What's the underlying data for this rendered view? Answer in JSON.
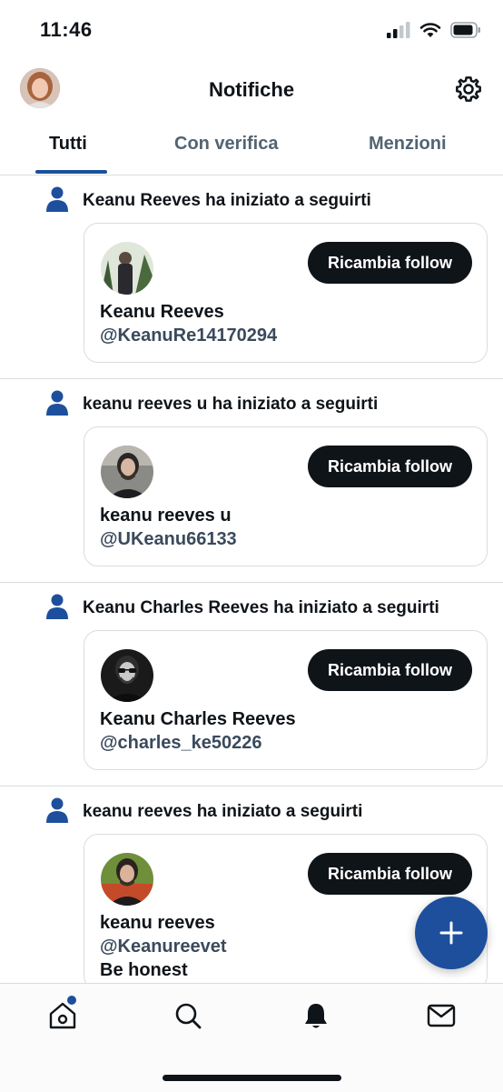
{
  "status_bar": {
    "time": "11:46"
  },
  "header": {
    "title": "Notifiche"
  },
  "tabs": [
    {
      "label": "Tutti",
      "active": true
    },
    {
      "label": "Con verifica",
      "active": false
    },
    {
      "label": "Menzioni",
      "active": false
    }
  ],
  "notifications": [
    {
      "text": "Keanu Reeves ha iniziato a seguirti",
      "name": "Keanu Reeves",
      "handle": "@KeanuRe14170294",
      "button": "Ricambia follow"
    },
    {
      "text": "keanu reeves u ha iniziato a seguirti",
      "name": "keanu reeves u",
      "handle": "@UKeanu66133",
      "button": "Ricambia follow"
    },
    {
      "text": "Keanu Charles Reeves ha iniziato a seguirti",
      "name": "Keanu Charles Reeves",
      "handle": "@charles_ke50226",
      "button": "Ricambia follow"
    },
    {
      "text": "keanu reeves ha iniziato a seguirti",
      "name": "keanu reeves",
      "handle": "@Keanureevet",
      "bio": "Be honest",
      "button": "Ricambia follow"
    }
  ],
  "colors": {
    "accent": "#1d4f9c",
    "text": "#0f1419",
    "secondary": "#536471"
  },
  "icons": [
    "signal-icon",
    "wifi-icon",
    "battery-icon",
    "gear-icon",
    "person-icon",
    "plus-icon",
    "home-icon",
    "search-icon",
    "bell-icon",
    "mail-icon"
  ]
}
